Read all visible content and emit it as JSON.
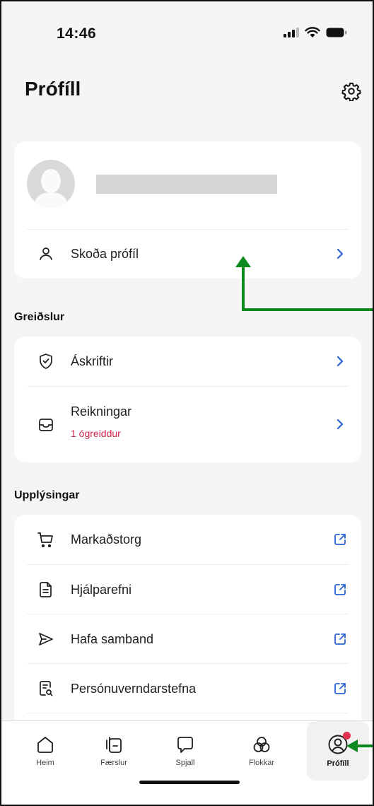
{
  "status_bar": {
    "time": "14:46"
  },
  "header": {
    "title": "Prófíll"
  },
  "profile": {
    "view_label": "Skoða prófíl"
  },
  "payments": {
    "section_title": "Greiðslur",
    "items": [
      {
        "label": "Áskriftir",
        "icon": "shield-check-icon"
      },
      {
        "label": "Reikningar",
        "sublabel": "1 ógreiddur",
        "icon": "inbox-icon"
      }
    ]
  },
  "info": {
    "section_title": "Upplýsingar",
    "items": [
      {
        "label": "Markaðstorg",
        "icon": "cart-icon"
      },
      {
        "label": "Hjálparefni",
        "icon": "document-icon"
      },
      {
        "label": "Hafa samband",
        "icon": "send-icon"
      },
      {
        "label": "Persónuverndarstefna",
        "icon": "policy-icon"
      }
    ]
  },
  "nav": {
    "items": [
      {
        "label": "Heim",
        "icon": "home-icon"
      },
      {
        "label": "Færslur",
        "icon": "transactions-icon"
      },
      {
        "label": "Spjall",
        "icon": "chat-icon"
      },
      {
        "label": "Flokkar",
        "icon": "categories-icon"
      },
      {
        "label": "Prófíll",
        "icon": "profile-icon",
        "active": true
      }
    ]
  },
  "colors": {
    "accent": "#2a62d4",
    "alert": "#d6264a",
    "annotation": "#0d8a1f",
    "badge": "#e0334f"
  }
}
